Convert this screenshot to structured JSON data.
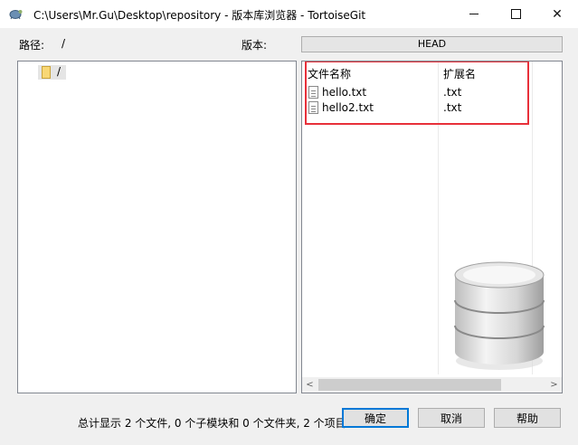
{
  "window": {
    "title": "C:\\Users\\Mr.Gu\\Desktop\\repository - 版本库浏览器 - TortoiseGit",
    "minimize_glyph": "",
    "maximize_glyph": "",
    "close_glyph": "✕"
  },
  "header": {
    "path_label": "路径:",
    "path_value": "/",
    "version_label": "版本:",
    "version_value": "HEAD"
  },
  "tree": {
    "root_label": "/"
  },
  "file_list": {
    "columns": [
      "文件名称",
      "扩展名"
    ],
    "sort_indicator": "^",
    "rows": [
      {
        "name": "hello.txt",
        "ext": ".txt"
      },
      {
        "name": "hello2.txt",
        "ext": ".txt"
      }
    ]
  },
  "scrollbar": {
    "left_arrow": "<",
    "right_arrow": ">"
  },
  "footer": {
    "status_text": "总计显示 2 个文件, 0 个子模块和 0 个文件夹, 2 个项目",
    "ok_label": "确定",
    "cancel_label": "取消",
    "help_label": "帮助"
  },
  "colors": {
    "highlight_box": "#e8303a",
    "ok_border": "#0078d7",
    "folder": "#f8d775"
  },
  "icons": [
    "tortoisegit-app-icon",
    "minimize-icon",
    "maximize-icon",
    "close-icon",
    "folder-icon",
    "text-file-icon",
    "sort-up-icon",
    "database-icon"
  ]
}
